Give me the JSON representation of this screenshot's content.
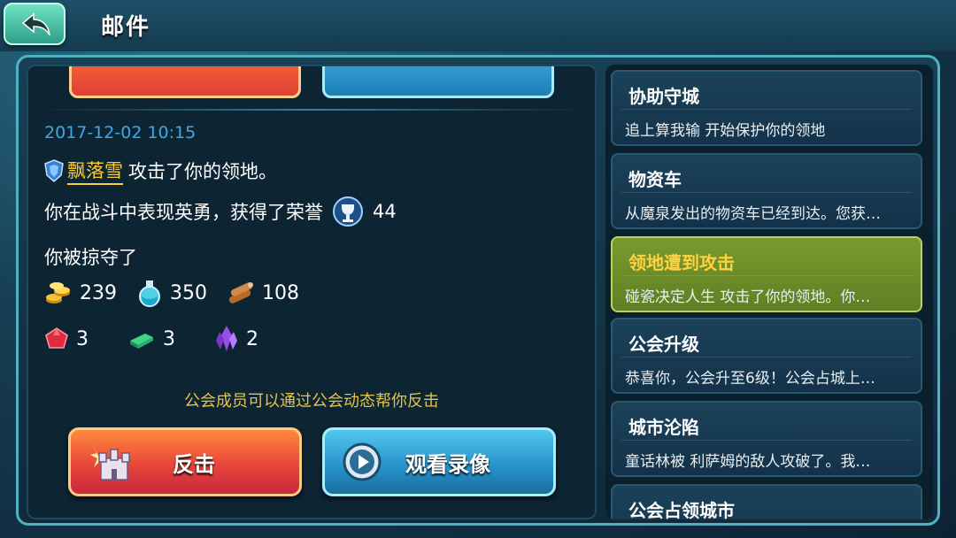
{
  "header": {
    "title": "邮件"
  },
  "detail": {
    "top_buttons": {
      "attack_label": "反击",
      "watch_label": "观看录像"
    },
    "date": "2017-12-02 10:15",
    "player_name": "飘落雪",
    "attack_text": "攻击了你的领地。",
    "honor_text": "你在战斗中表现英勇，获得了荣誉",
    "honor_value": "44",
    "plunder_text": "你被掠夺了",
    "resources_row1": [
      {
        "icon": "gold-coins-icon",
        "value": "239"
      },
      {
        "icon": "potion-flask-icon",
        "value": "350"
      },
      {
        "icon": "wood-logs-icon",
        "value": "108"
      }
    ],
    "resources_row2": [
      {
        "icon": "red-gem-icon",
        "value": "3"
      },
      {
        "icon": "green-bar-icon",
        "value": "3"
      },
      {
        "icon": "purple-crystal-icon",
        "value": "2"
      }
    ],
    "hint": "公会成员可以通过公会动态帮你反击",
    "buttons": {
      "attack_label": "反击",
      "watch_label": "观看录像"
    }
  },
  "mail_list": [
    {
      "title": "协助守城",
      "preview": "追上算我输 开始保护你的领地",
      "active": false
    },
    {
      "title": "物资车",
      "preview": "从魔泉发出的物资车已经到达。您获…",
      "active": false
    },
    {
      "title": "领地遭到攻击",
      "preview": "碰瓷决定人生 攻击了你的领地。你…",
      "active": true
    },
    {
      "title": "公会升级",
      "preview": "恭喜你，公会升至6级！公会占城上…",
      "active": false
    },
    {
      "title": "城市沦陷",
      "preview": "童话林被 利萨姆的敌人攻破了。我…",
      "active": false
    },
    {
      "title": "公会占领城市",
      "preview": "",
      "active": false
    }
  ],
  "colors": {
    "accent_blue": "#3fa8e8",
    "player_gold": "#ffcc33",
    "hint_yellow": "#e6c44a",
    "active_item_green": "#6f8f29"
  }
}
